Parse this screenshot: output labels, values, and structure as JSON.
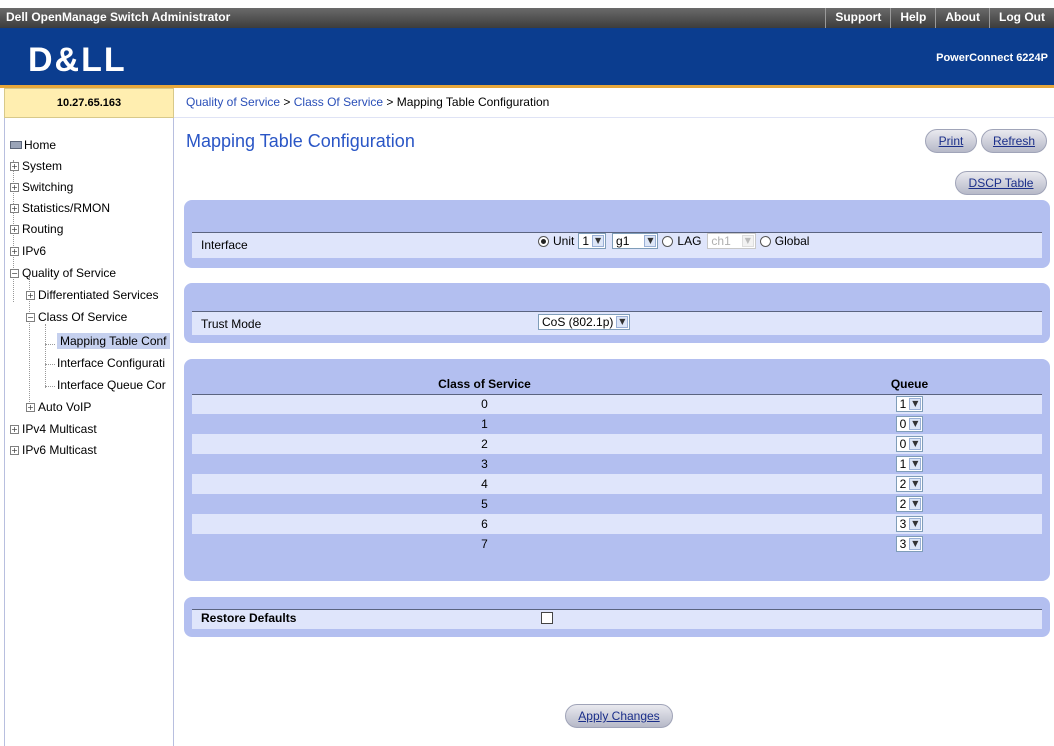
{
  "window": {
    "app_title": "Dell OpenManage Switch Administrator",
    "links": [
      "Support",
      "Help",
      "About",
      "Log Out"
    ]
  },
  "header": {
    "logo": "D&LL",
    "model": "PowerConnect 6224P"
  },
  "ip_address": "10.27.65.163",
  "breadcrumb": {
    "items": [
      "Quality of Service",
      "Class Of Service"
    ],
    "separator": " > ",
    "current": "Mapping Table Configuration"
  },
  "nav": {
    "items": [
      {
        "label": "Home",
        "icon": "home-icon"
      },
      {
        "label": "System",
        "icon": "expand-icon"
      },
      {
        "label": "Switching",
        "icon": "expand-icon"
      },
      {
        "label": "Statistics/RMON",
        "icon": "expand-icon"
      },
      {
        "label": "Routing",
        "icon": "expand-icon"
      },
      {
        "label": "IPv6",
        "icon": "expand-icon"
      },
      {
        "label": "Quality of Service",
        "icon": "collapse-icon"
      },
      {
        "label": "Differentiated Services",
        "icon": "expand-icon"
      },
      {
        "label": "Class Of Service",
        "icon": "collapse-icon"
      },
      {
        "label": "Mapping Table Conf",
        "selected": true
      },
      {
        "label": "Interface Configurati"
      },
      {
        "label": "Interface Queue Cor"
      },
      {
        "label": "Auto VoIP",
        "icon": "expand-icon"
      },
      {
        "label": "IPv4 Multicast",
        "icon": "expand-icon"
      },
      {
        "label": "IPv6 Multicast",
        "icon": "expand-icon"
      }
    ]
  },
  "page": {
    "title": "Mapping Table Configuration",
    "buttons": {
      "print": "Print",
      "refresh": "Refresh",
      "dscp": "DSCP Table",
      "apply": "Apply Changes"
    }
  },
  "interface": {
    "label": "Interface",
    "unit_label": "Unit",
    "unit_value": "1",
    "port_value": "g1",
    "lag_label": "LAG",
    "lag_value": "ch1",
    "global_label": "Global",
    "selected": "Unit"
  },
  "trust": {
    "label": "Trust Mode",
    "value": "CoS (802.1p)"
  },
  "cos_table": {
    "headers": [
      "Class of Service",
      "Queue"
    ],
    "rows": [
      {
        "cos": "0",
        "queue": "1"
      },
      {
        "cos": "1",
        "queue": "0"
      },
      {
        "cos": "2",
        "queue": "0"
      },
      {
        "cos": "3",
        "queue": "1"
      },
      {
        "cos": "4",
        "queue": "2"
      },
      {
        "cos": "5",
        "queue": "2"
      },
      {
        "cos": "6",
        "queue": "3"
      },
      {
        "cos": "7",
        "queue": "3"
      }
    ]
  },
  "restore": {
    "label": "Restore Defaults",
    "checked": false
  },
  "colors": {
    "header_blue": "#0b3d8f",
    "accent_orange": "#e7a73b",
    "panel": "#b3bff0",
    "panel_light": "#dfe5fb",
    "title_blue": "#2a56c6"
  }
}
